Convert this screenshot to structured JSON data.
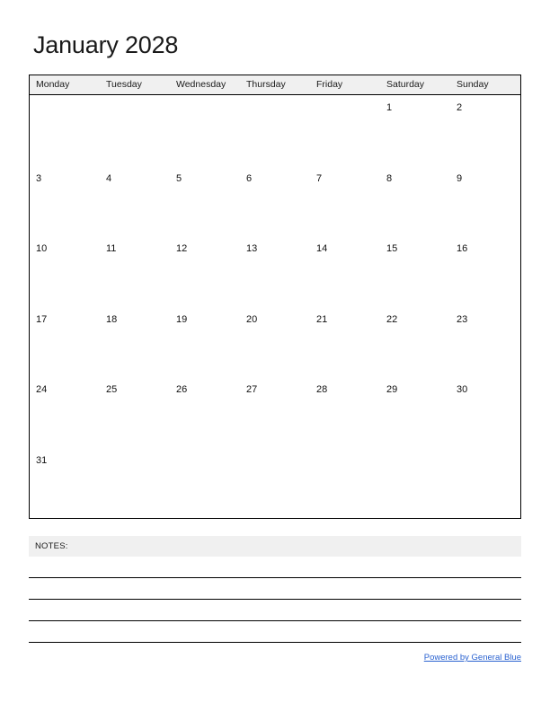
{
  "document": {
    "title": "January 2028",
    "month": "January",
    "year": "2028"
  },
  "colors": {
    "header_background": "#f0f0f0",
    "border": "#000000",
    "text": "#1a1a1a",
    "link": "#2a62d0",
    "page_background": "#ffffff"
  },
  "calendar": {
    "weekdays": [
      {
        "label": "Monday"
      },
      {
        "label": "Tuesday"
      },
      {
        "label": "Wednesday"
      },
      {
        "label": "Thursday"
      },
      {
        "label": "Friday"
      },
      {
        "label": "Saturday"
      },
      {
        "label": "Sunday"
      }
    ],
    "weeks": [
      [
        "",
        "",
        "",
        "",
        "",
        "1",
        "2"
      ],
      [
        "3",
        "4",
        "5",
        "6",
        "7",
        "8",
        "9"
      ],
      [
        "10",
        "11",
        "12",
        "13",
        "14",
        "15",
        "16"
      ],
      [
        "17",
        "18",
        "19",
        "20",
        "21",
        "22",
        "23"
      ],
      [
        "24",
        "25",
        "26",
        "27",
        "28",
        "29",
        "30"
      ],
      [
        "31",
        "",
        "",
        "",
        "",
        "",
        ""
      ]
    ]
  },
  "notes": {
    "label": "NOTES:",
    "line_count": 4
  },
  "footer": {
    "link_text": "Powered by General Blue"
  }
}
